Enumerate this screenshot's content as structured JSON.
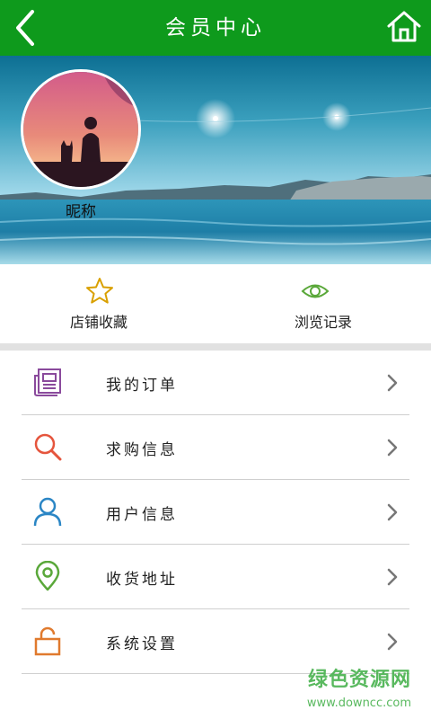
{
  "header": {
    "title": "会员中心",
    "back_icon": "back-arrow-icon",
    "home_icon": "home-icon",
    "color": "#0e9a1c"
  },
  "profile": {
    "nickname": "昵称"
  },
  "quick_actions": [
    {
      "label": "店铺收藏",
      "icon": "star-icon",
      "color": "#d9a000"
    },
    {
      "label": "浏览记录",
      "icon": "eye-icon",
      "color": "#5aa83a"
    }
  ],
  "menu": [
    {
      "label": "我的订单",
      "icon": "order-document-icon",
      "color": "#8a4a9c"
    },
    {
      "label": "求购信息",
      "icon": "search-icon",
      "color": "#e5553d"
    },
    {
      "label": "用户信息",
      "icon": "user-icon",
      "color": "#2b86c5"
    },
    {
      "label": "收货地址",
      "icon": "location-pin-icon",
      "color": "#5aa83a"
    },
    {
      "label": "系统设置",
      "icon": "unlock-icon",
      "color": "#e07a2e"
    }
  ],
  "watermark": {
    "text": "绿色资源网",
    "url": "www.downcc.com"
  }
}
